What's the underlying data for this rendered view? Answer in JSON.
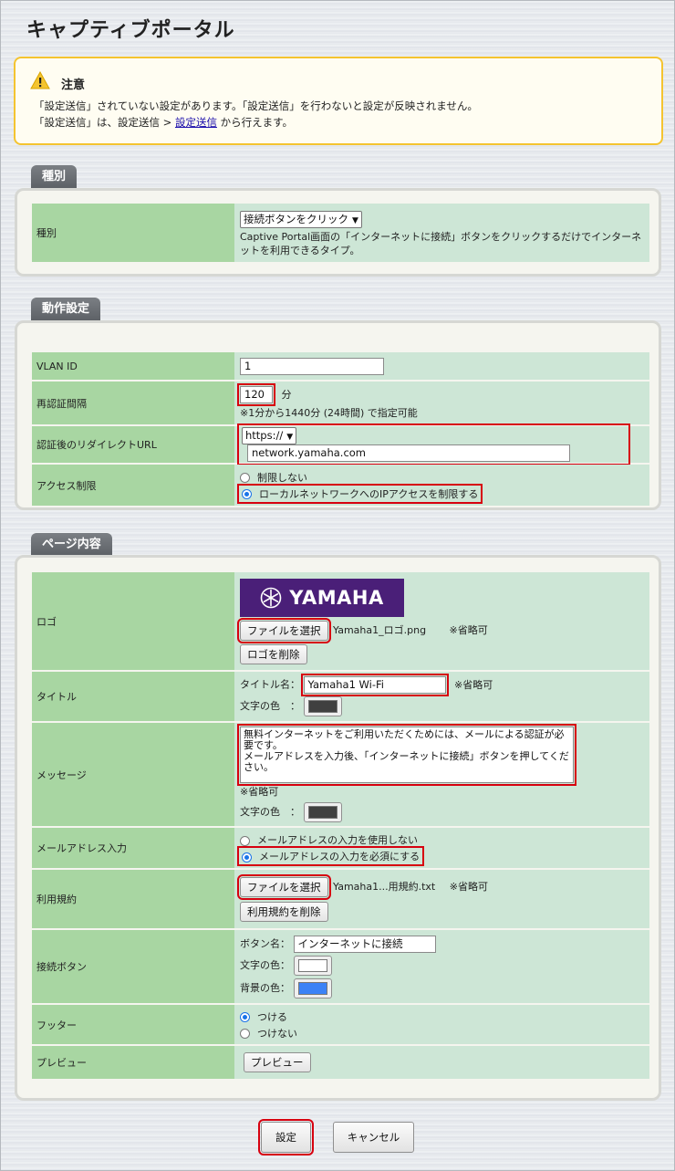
{
  "page": {
    "title": "キャプティブポータル"
  },
  "notice": {
    "title": "注意",
    "line1": "「設定送信」されていない設定があります。「設定送信」を行わないと設定が反映されません。",
    "line2_prefix": "「設定送信」は、設定送信 > ",
    "line2_link": "設定送信",
    "line2_suffix": " から行えます。"
  },
  "sections": {
    "kind": {
      "tab": "種別",
      "label": "種別",
      "select_value": "接続ボタンをクリック",
      "description": "Captive Portal画面の「インターネットに接続」ボタンをクリックするだけでインターネットを利用できるタイプ。"
    },
    "operation": {
      "tab": "動作設定",
      "vlan": {
        "label": "VLAN ID",
        "value": "1"
      },
      "reauth": {
        "label": "再認証間隔",
        "value": "120",
        "unit": "分",
        "note": "※1分から1440分 (24時間) で指定可能"
      },
      "redirect": {
        "label": "認証後のリダイレクトURL",
        "scheme": "https://",
        "url": "network.yamaha.com"
      },
      "access": {
        "label": "アクセス制限",
        "opt1": "制限しない",
        "opt2": "ローカルネットワークへのIPアクセスを制限する",
        "selected": 2
      }
    },
    "content": {
      "tab": "ページ内容",
      "logo": {
        "label": "ロゴ",
        "logo_text": "YAMAHA",
        "choose": "ファイルを選択",
        "filename": "Yamaha1_ロゴ.png",
        "optional": "※省略可",
        "delete": "ロゴを削除"
      },
      "title": {
        "label": "タイトル",
        "name_label": "タイトル名：",
        "value": "Yamaha1 Wi-Fi",
        "optional": "※省略可",
        "color_label": "文字の色　："
      },
      "message": {
        "label": "メッセージ",
        "value": "無料インターネットをご利用いただくためには、メールによる認証が必要です。\nメールアドレスを入力後、「インターネットに接続」ボタンを押してください。",
        "optional": "※省略可",
        "color_label": "文字の色　："
      },
      "mail": {
        "label": "メールアドレス入力",
        "opt1": "メールアドレスの入力を使用しない",
        "opt2": "メールアドレスの入力を必須にする",
        "selected": 2
      },
      "terms": {
        "label": "利用規約",
        "choose": "ファイルを選択",
        "filename": "Yamaha1...用規約.txt",
        "optional": "※省略可",
        "delete": "利用規約を削除"
      },
      "connect": {
        "label": "接続ボタン",
        "name_label": "ボタン名：",
        "value": "インターネットに接続",
        "text_color_label": "文字の色：",
        "bg_color_label": "背景の色："
      },
      "footer": {
        "label": "フッター",
        "opt1": "つける",
        "opt2": "つけない",
        "selected": 1
      },
      "preview": {
        "label": "プレビュー",
        "button": "プレビュー"
      }
    }
  },
  "actions": {
    "submit": "設定",
    "cancel": "キャンセル"
  },
  "colors": {
    "title_text": "#404040",
    "message_text": "#404040",
    "button_text": "#ffffff",
    "button_bg": "#3b82f6",
    "logo_bg": "#4a1f78",
    "highlight": "#d7000f"
  }
}
